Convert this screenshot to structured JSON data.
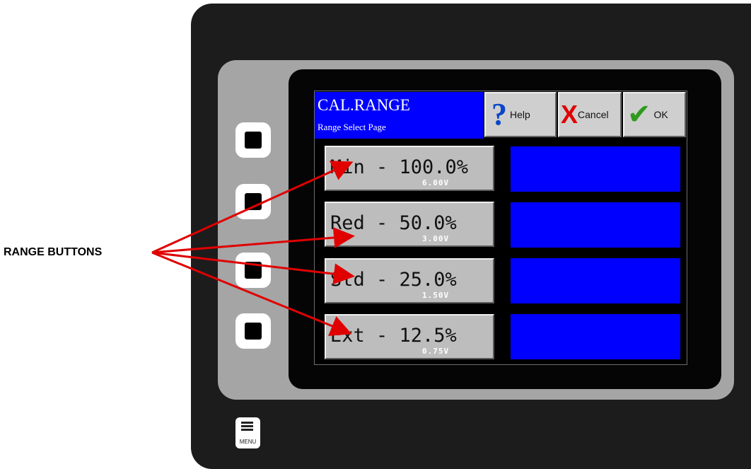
{
  "header": {
    "title": "CAL.RANGE",
    "subtitle": "Range Select Page"
  },
  "toolbar": {
    "help_label": "Help",
    "cancel_label": "Cancel",
    "ok_label": "OK"
  },
  "ranges": [
    {
      "label": "Min - 100.0%",
      "voltage": "6.00V"
    },
    {
      "label": "Red - 50.0%",
      "voltage": "3.00V"
    },
    {
      "label": "Std - 25.0%",
      "voltage": "1.50V"
    },
    {
      "label": "Ext - 12.5%",
      "voltage": "0.75V"
    }
  ],
  "menu_key": {
    "label": "MENU"
  },
  "annotation": {
    "text": "RANGE BUTTONS"
  },
  "colors": {
    "title_bg": "#0000ff",
    "bar": "#0000ff",
    "arrow": "#e00000",
    "button_gray": "#bdbdbd"
  }
}
